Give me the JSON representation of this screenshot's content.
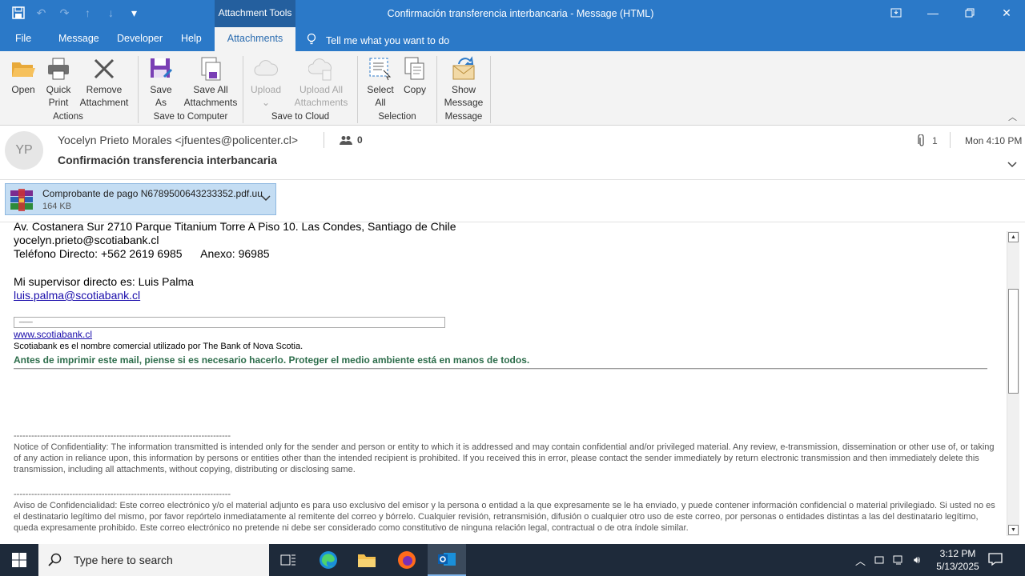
{
  "titlebar": {
    "context_tab": "Attachment Tools",
    "title": "Confirmación transferencia interbancaria  -  Message (HTML)"
  },
  "menu": {
    "tabs": [
      "File",
      "Message",
      "Developer",
      "Help",
      "Attachments"
    ],
    "active": "Attachments",
    "tell_me": "Tell me what you want to do"
  },
  "ribbon": {
    "groups": {
      "actions": "Actions",
      "save_to_computer": "Save to Computer",
      "save_to_cloud": "Save to Cloud",
      "selection": "Selection",
      "message": "Message"
    },
    "buttons": {
      "open": "Open",
      "quick_print_1": "Quick",
      "quick_print_2": "Print",
      "remove_1": "Remove",
      "remove_2": "Attachment",
      "save_as_1": "Save",
      "save_as_2": "As",
      "save_all_1": "Save All",
      "save_all_2": "Attachments",
      "upload": "Upload",
      "upload_all_1": "Upload All",
      "upload_all_2": "Attachments",
      "select_all_1": "Select",
      "select_all_2": "All",
      "copy": "Copy",
      "show_message_1": "Show",
      "show_message_2": "Message"
    }
  },
  "header": {
    "avatar_initials": "YP",
    "sender": "Yocelyn Prieto Morales <jfuentes@policenter.cl>",
    "people_count": "0",
    "subject": "Confirmación transferencia interbancaria",
    "attachment_count": "1",
    "date": "Mon 4:10 PM"
  },
  "attachment": {
    "name": "Comprobante de pago N6789500643233352.pdf.uu",
    "size": "164 KB"
  },
  "body": {
    "cut_line": "Av. Costanera Sur 2710 Parque Titanium Torre A Piso 10. Las Condes, Santiago de Chile",
    "email": "yocelyn.prieto@scotiabank.cl",
    "phone": "Teléfono Directo: +562 2619 6985      Anexo: 96985",
    "supervisor": "Mi supervisor directo es: Luis Palma",
    "supervisor_email": "luis.palma@scotiabank.cl",
    "box_text": "___",
    "website": "www.scotiabank.cl",
    "commercial_name": "Scotiabank es el nombre comercial utilizado por The Bank of Nova Scotia.",
    "eco_note": "Antes de imprimir este mail, piense si es necesario hacerlo. Proteger el medio ambiente está en manos de todos.",
    "dashes_1": "--------------------------------------------------------------------------",
    "notice_en": "Notice of Confidentiality: The information transmitted is intended only for the sender and person or entity to which it is addressed and may contain confidential and/or privileged material. Any review, e-transmission, dissemination or other use of, or taking of any action in reliance upon, this information by persons or entities other than the intended recipient is prohibited. If you received this in error, please contact the sender immediately by return electronic transmission and then immediately delete this transmission, including all attachments, without copying, distributing or disclosing same.",
    "dashes_2": "--------------------------------------------------------------------------",
    "notice_es": "Aviso de Confidencialidad: Este correo electrónico y/o el material adjunto es para uso exclusivo del emisor y la persona o entidad a la que expresamente se le ha enviado, y puede contener información confidencial o material privilegiado. Si usted no es el destinatario legítimo del mismo, por favor repórtelo inmediatamente al remitente del correo y bórrelo. Cualquier revisión, retransmisión, difusión o cualquier otro uso de este correo, por personas o entidades distintas a las del destinatario legítimo, queda expresamente prohibido. Este correo electrónico no pretende ni debe ser considerado como constitutivo de ninguna relación legal, contractual o de otra índole similar."
  },
  "taskbar": {
    "search_placeholder": "Type here to search",
    "time": "3:12 PM",
    "date": "5/13/2025"
  },
  "colors": {
    "accent": "#2b79c8",
    "ribbon_bg": "#f3f3f3",
    "attachment_selected": "#c4ddf3",
    "eco_green": "#2d6d4b",
    "taskbar": "#1e2a3a"
  }
}
